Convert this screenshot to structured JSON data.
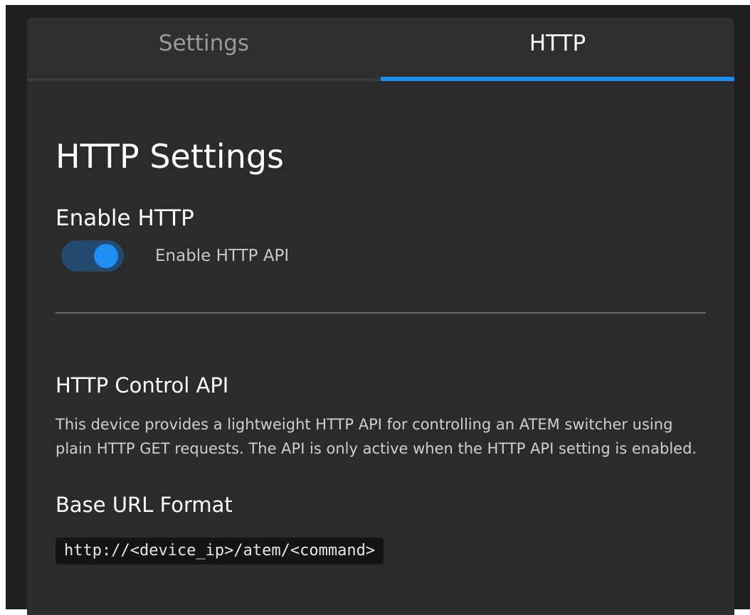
{
  "tabs": [
    {
      "label": "Settings",
      "active": false
    },
    {
      "label": "HTTP",
      "active": true
    }
  ],
  "page": {
    "title": "HTTP Settings"
  },
  "enable_section": {
    "label": "Enable HTTP",
    "toggle_label": "Enable HTTP API",
    "toggle_on": true
  },
  "api_section": {
    "heading": "HTTP Control API",
    "description": "This device provides a lightweight HTTP API for controlling an ATEM switcher using plain HTTP GET requests. The API is only active when the HTTP API setting is enabled."
  },
  "url_section": {
    "heading": "Base URL Format",
    "code": "http://<device_ip>/atem/<command>"
  },
  "colors": {
    "accent": "#1e8ef0",
    "panel_bg": "#2b2b2b",
    "toggle_track": "#244a6e"
  }
}
